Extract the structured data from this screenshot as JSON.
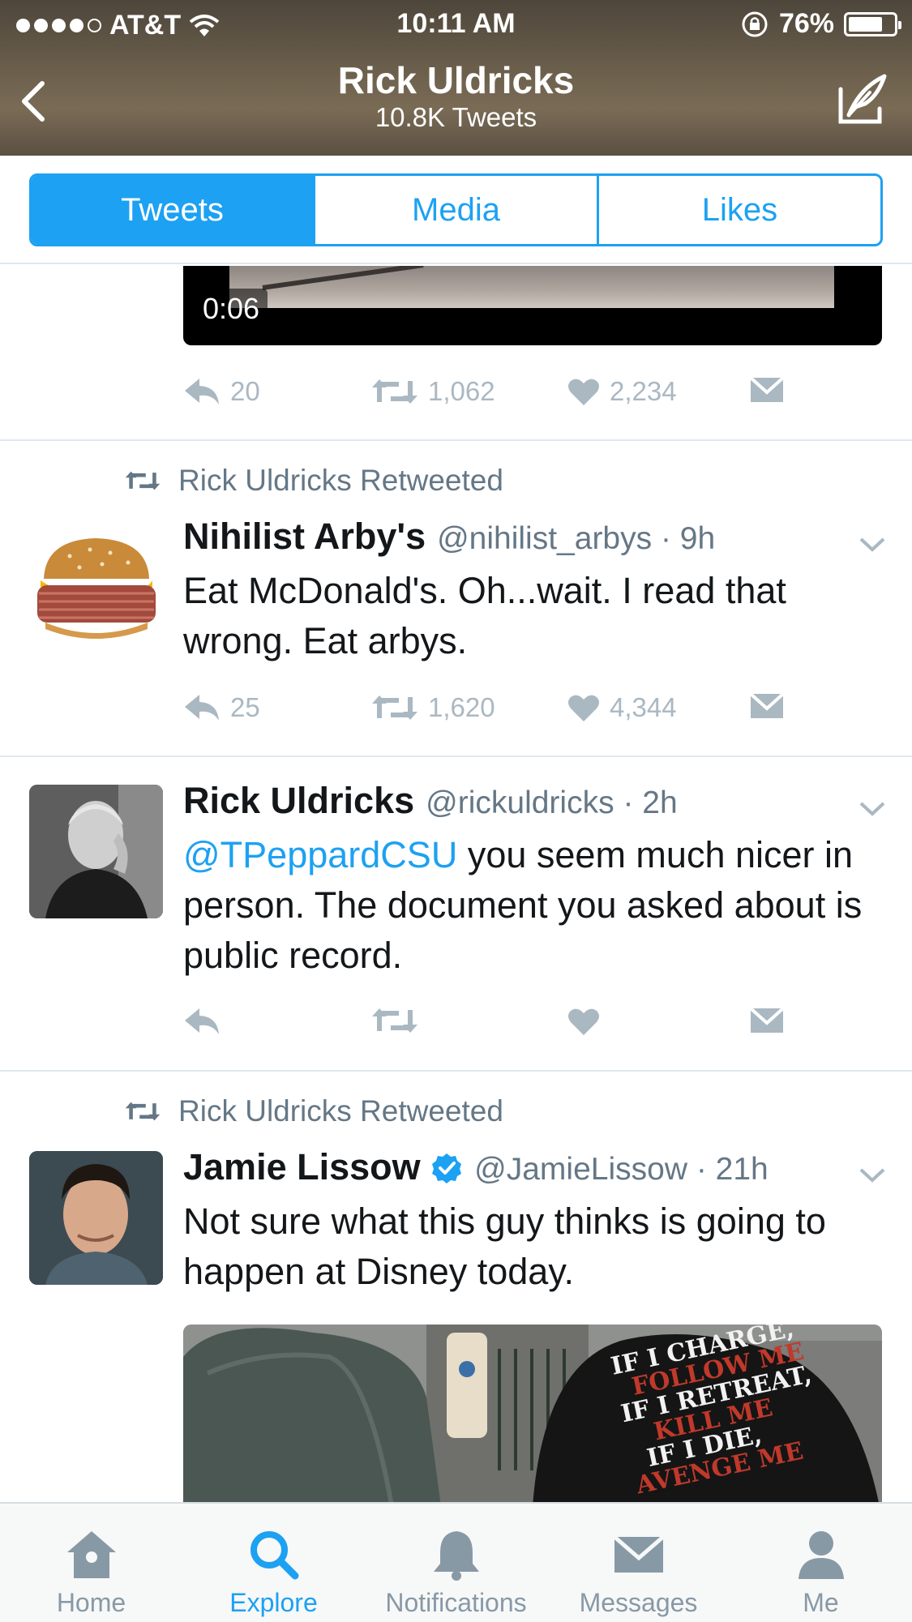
{
  "status_bar": {
    "carrier": "AT&T",
    "time": "10:11 AM",
    "battery": "76%",
    "battery_level": 0.76
  },
  "nav": {
    "title": "Rick Uldricks",
    "subtitle": "10.8K Tweets"
  },
  "tabs": [
    {
      "label": "Tweets",
      "active": true
    },
    {
      "label": "Media",
      "active": false
    },
    {
      "label": "Likes",
      "active": false
    }
  ],
  "tweets": [
    {
      "video_duration": "0:06",
      "replies": "20",
      "retweets": "1,062",
      "likes": "2,234"
    },
    {
      "retweeted_by": "Rick Uldricks Retweeted",
      "name": "Nihilist Arby's",
      "handle": "@nihilist_arbys",
      "time": "· 9h",
      "text": "Eat McDonald's. Oh...wait. I read that wrong. Eat arbys.",
      "replies": "25",
      "retweets": "1,620",
      "likes": "4,344"
    },
    {
      "name": "Rick Uldricks",
      "handle": "@rickuldricks",
      "time": "· 2h",
      "mention": "@TPeppardCSU",
      "text": " you seem much nicer in person. The document you asked about is public record.",
      "replies": "",
      "retweets": "",
      "likes": ""
    },
    {
      "retweeted_by": "Rick Uldricks Retweeted",
      "name": "Jamie Lissow",
      "handle": "@JamieLissow",
      "time": "· 21h",
      "text": "Not sure what this guy thinks is going to happen at Disney today.",
      "photo_shirt_text": [
        "IF I CHARGE,",
        "FOLLOW ME",
        "IF I RETREAT,",
        "KILL ME",
        "IF I DIE,",
        "AVENGE ME"
      ]
    }
  ],
  "tabbar": [
    {
      "label": "Home",
      "icon": "home-icon",
      "active": false
    },
    {
      "label": "Explore",
      "icon": "search-icon",
      "active": true
    },
    {
      "label": "Notifications",
      "icon": "bell-icon",
      "active": false
    },
    {
      "label": "Messages",
      "icon": "envelope-icon",
      "active": false
    },
    {
      "label": "Me",
      "icon": "person-icon",
      "active": false
    }
  ],
  "colors": {
    "accent": "#1da1f2",
    "icon_gray": "#aab8c2",
    "secondary_text": "#657786"
  }
}
